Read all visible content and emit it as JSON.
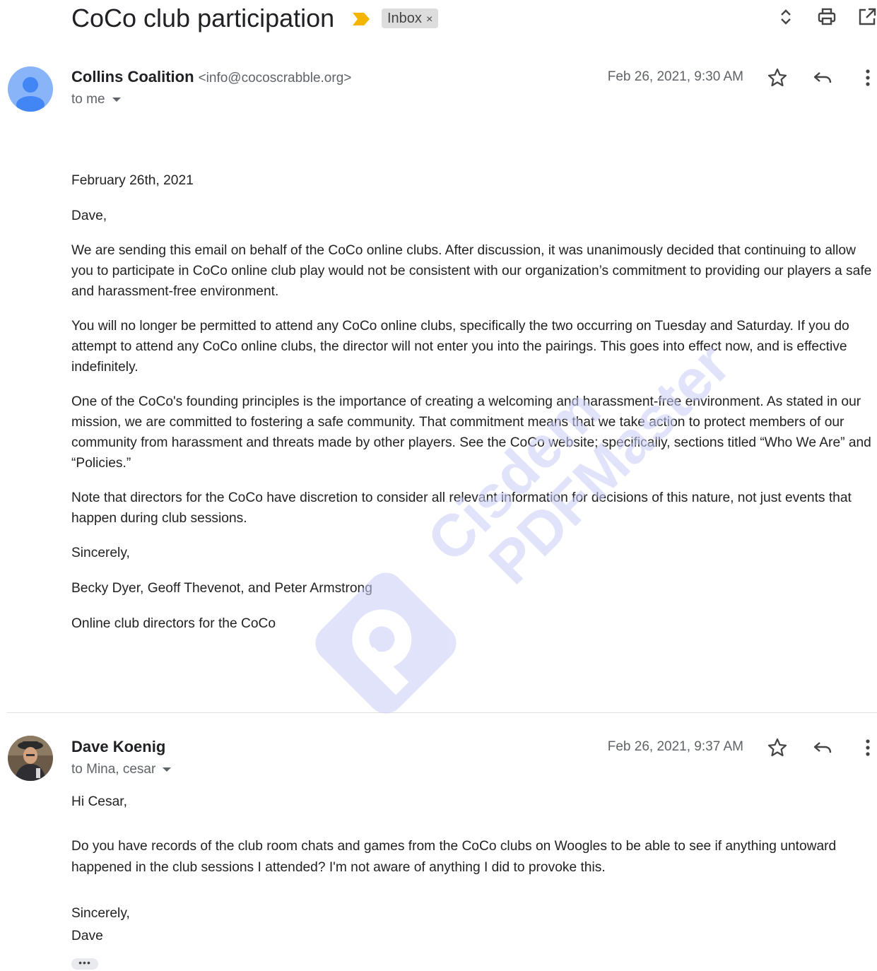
{
  "thread": {
    "subject": "CoCo club participation",
    "label": "Inbox",
    "label_remove": "×"
  },
  "messages": [
    {
      "sender_name": "Collins Coalition",
      "sender_email": "<info@cocoscrabble.org>",
      "recipients": "to me",
      "date": "Feb 26, 2021, 9:30 AM",
      "body": [
        "February 26th, 2021",
        "Dave,",
        "We are sending this email on behalf of the CoCo online clubs. After discussion, it was unanimously decided that continuing to allow you to participate in CoCo online club play would not be consistent with our organization’s commitment to providing our players a safe and harassment-free environment.",
        "You will no longer be permitted to attend any CoCo online clubs, specifically the two occurring on Tuesday and Saturday. If you do attempt to attend any CoCo online clubs, the director will not enter you into the pairings. This goes into effect now, and is effective indefinitely.",
        "One of the CoCo's founding principles is the importance of creating a welcoming and harassment-free environment. As stated in our mission, we are committed to fostering a safe community. That commitment means that we take action to protect members of our community from harassment and threats made by other players. See the CoCo website; specifically, sections titled “Who We Are” and “Policies.”",
        "Note that directors for the CoCo have discretion to consider all relevant information for decisions of this nature, not just events that happen during club sessions.",
        "Sincerely,",
        "Becky Dyer, Geoff Thevenot, and Peter Armstrong",
        "Online club directors for the CoCo"
      ]
    },
    {
      "sender_name": "Dave Koenig",
      "sender_email": "",
      "recipients": "to Mina, cesar",
      "date": "Feb 26, 2021, 9:37 AM",
      "body": [
        "Hi Cesar,",
        "Do you have records of the club room chats and games from the CoCo clubs on Woogles to be able to see if anything untoward happened in the club sessions I attended? I'm not aware of anything I did to provoke this.",
        "Sincerely,",
        "Dave"
      ],
      "trimmed_content": "•••"
    }
  ],
  "watermark": {
    "line1": "Cisdem",
    "line2": "PDFMaster"
  },
  "colors": {
    "importance": "#f4b400",
    "avatar_default": "#4285f4",
    "watermark": "#c9cdf7"
  },
  "icons": {
    "expand": "unfold-icon",
    "print": "print-icon",
    "popout": "open-in-new-icon",
    "star": "star-icon",
    "reply": "reply-icon",
    "more": "more-vert-icon"
  }
}
